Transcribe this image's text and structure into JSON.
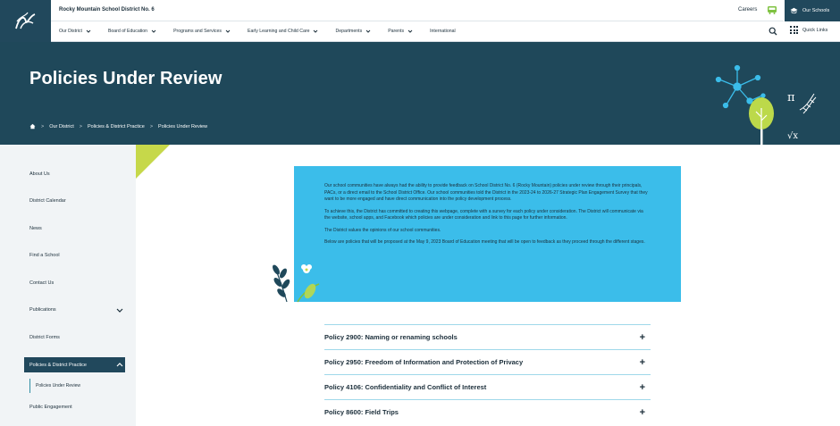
{
  "header": {
    "district_name": "Rocky Mountain School District No. 6",
    "careers_label": "Careers",
    "our_schools_label": "Our Schools",
    "quick_links_label": "Quick Links"
  },
  "nav": {
    "items": [
      {
        "label": "Our District",
        "has_dropdown": true
      },
      {
        "label": "Board of Education",
        "has_dropdown": true
      },
      {
        "label": "Programs and Services",
        "has_dropdown": true
      },
      {
        "label": "Early Learning and Child Care",
        "has_dropdown": true
      },
      {
        "label": "Departments",
        "has_dropdown": true
      },
      {
        "label": "Parents",
        "has_dropdown": true
      },
      {
        "label": "International",
        "has_dropdown": false
      }
    ]
  },
  "hero": {
    "title": "Policies Under Review",
    "breadcrumb": [
      "Our District",
      "Policies & District Practice",
      "Policies Under Review"
    ]
  },
  "sidebar": {
    "items": [
      {
        "label": "About Us"
      },
      {
        "label": "District Calendar"
      },
      {
        "label": "News"
      },
      {
        "label": "Find a School"
      },
      {
        "label": "Contact Us"
      },
      {
        "label": "Publications"
      },
      {
        "label": "District Forms"
      },
      {
        "label": "Policies & District Practice"
      },
      {
        "label": "Public Engagement"
      }
    ],
    "sub_item": "Policies Under Review"
  },
  "intro": {
    "paragraphs": [
      "Our school communities have always had the ability to provide feedback on School District No. 6 (Rocky Mountain) policies under review through their principals, PACs, or a direct email to the School District Office.  Our school communities told the District in the 2023-24 to 2026-27 Strategic Plan Engagement Survey that they want to be more engaged and have direct communication into the policy development process.",
      "To achieve this, the District has committed to creating this webpage, complete with a survey for each policy under consideration.  The District will communicate via the website, school apps, and Facebook which policies are under consideration and link to this page for further information.",
      "The District values the opinions of our school communities.",
      "Below are policies that will be proposed at the May 9, 2023 Board of Education meeting that will be open to feedback as they proceed through the different stages."
    ]
  },
  "policies": [
    {
      "label": "Policy 2900: Naming or renaming schools"
    },
    {
      "label": "Policy 2950: Freedom of Information and Protection of Privacy"
    },
    {
      "label": "Policy 4106: Confidentiality and Conflict of Interest"
    },
    {
      "label": "Policy 8600: Field Trips"
    }
  ],
  "colors": {
    "primary": "#21485c",
    "hero": "#1f485a",
    "intro_bg": "#3bbdea",
    "accent": "#c6d84a"
  }
}
